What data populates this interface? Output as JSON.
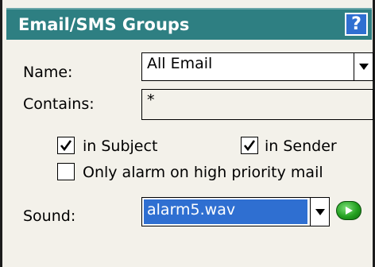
{
  "title": "Email/SMS Groups",
  "help_label": "?",
  "name": {
    "label": "Name:",
    "value": "All Email"
  },
  "contains": {
    "label": "Contains:",
    "value": "*"
  },
  "options": {
    "in_subject": {
      "label": "in Subject",
      "checked": true
    },
    "in_sender": {
      "label": "in Sender",
      "checked": true
    },
    "high_priority": {
      "label": "Only alarm on high priority mail",
      "checked": false
    }
  },
  "sound": {
    "label": "Sound:",
    "value": "alarm5.wav"
  },
  "icons": {
    "help": "help-icon",
    "dropdown": "chevron-down-icon",
    "play": "play-icon",
    "check": "check-icon"
  },
  "colors": {
    "titlebar": "#2e7f82",
    "selection": "#2f6fd1",
    "play": "#23a020"
  }
}
